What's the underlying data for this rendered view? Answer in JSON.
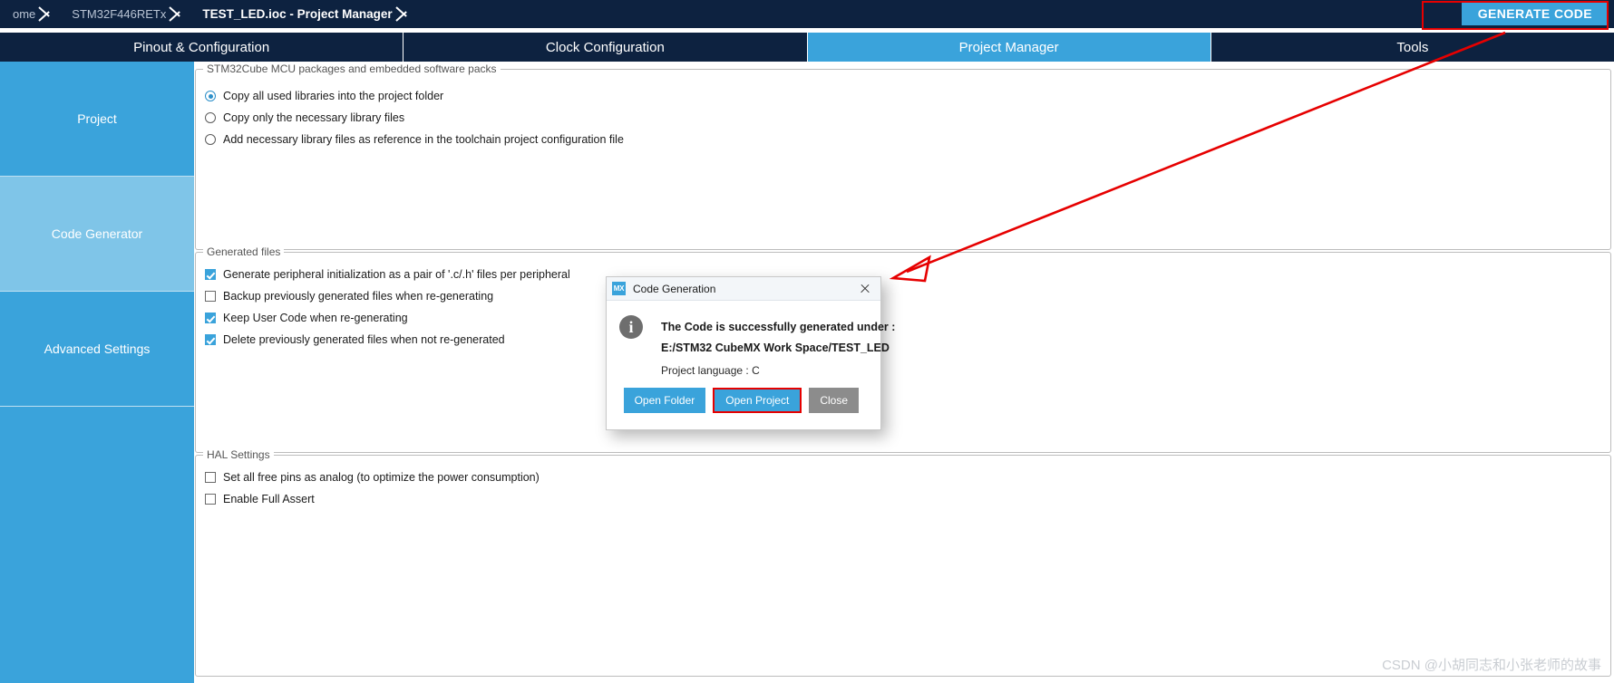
{
  "breadcrumb": {
    "items": [
      {
        "label": "ome",
        "active": false
      },
      {
        "label": "STM32F446RETx",
        "active": false
      },
      {
        "label": "TEST_LED.ioc - Project Manager",
        "active": true
      }
    ]
  },
  "toolbar": {
    "generate_code_label": "GENERATE CODE"
  },
  "tabs": [
    {
      "label": "Pinout & Configuration",
      "selected": false
    },
    {
      "label": "Clock Configuration",
      "selected": false
    },
    {
      "label": "Project Manager",
      "selected": true
    },
    {
      "label": "Tools",
      "selected": false
    }
  ],
  "sidebar": {
    "items": [
      {
        "label": "Project",
        "selected": false
      },
      {
        "label": "Code Generator",
        "selected": true
      },
      {
        "label": "Advanced Settings",
        "selected": false
      }
    ]
  },
  "groups": {
    "packages": {
      "title": "STM32Cube MCU packages and embedded software packs",
      "options": [
        {
          "label": "Copy all used libraries into the project folder",
          "checked": true
        },
        {
          "label": "Copy only the necessary library files",
          "checked": false
        },
        {
          "label": "Add necessary library files as reference in the toolchain project configuration file",
          "checked": false
        }
      ]
    },
    "generated_files": {
      "title": "Generated files",
      "options": [
        {
          "label": "Generate peripheral initialization as a pair of '.c/.h' files per peripheral",
          "checked": true
        },
        {
          "label": "Backup previously generated files when re-generating",
          "checked": false
        },
        {
          "label": "Keep User Code when re-generating",
          "checked": true
        },
        {
          "label": "Delete previously generated files when not re-generated",
          "checked": true
        }
      ]
    },
    "hal_settings": {
      "title": "HAL Settings",
      "options": [
        {
          "label": "Set all free pins as analog (to optimize the power consumption)",
          "checked": false
        },
        {
          "label": "Enable Full Assert",
          "checked": false
        }
      ]
    }
  },
  "dialog": {
    "logo_text": "MX",
    "title": "Code Generation",
    "info_glyph": "i",
    "message_line1": "The Code is successfully generated under :",
    "message_line2": "E:/STM32 CubeMX Work Space/TEST_LED",
    "message_line3": "Project language : C",
    "buttons": [
      {
        "label": "Open Folder",
        "style": "primary",
        "annotated": false
      },
      {
        "label": "Open Project",
        "style": "primary",
        "annotated": true
      },
      {
        "label": "Close",
        "style": "muted",
        "annotated": false
      }
    ]
  },
  "watermark": {
    "text": "CSDN @小胡同志和小张老师的故事"
  },
  "colors": {
    "navy": "#0d2240",
    "accent": "#3aa3db",
    "accent_light": "#7fc5e8",
    "annotation_red": "#e60000"
  }
}
